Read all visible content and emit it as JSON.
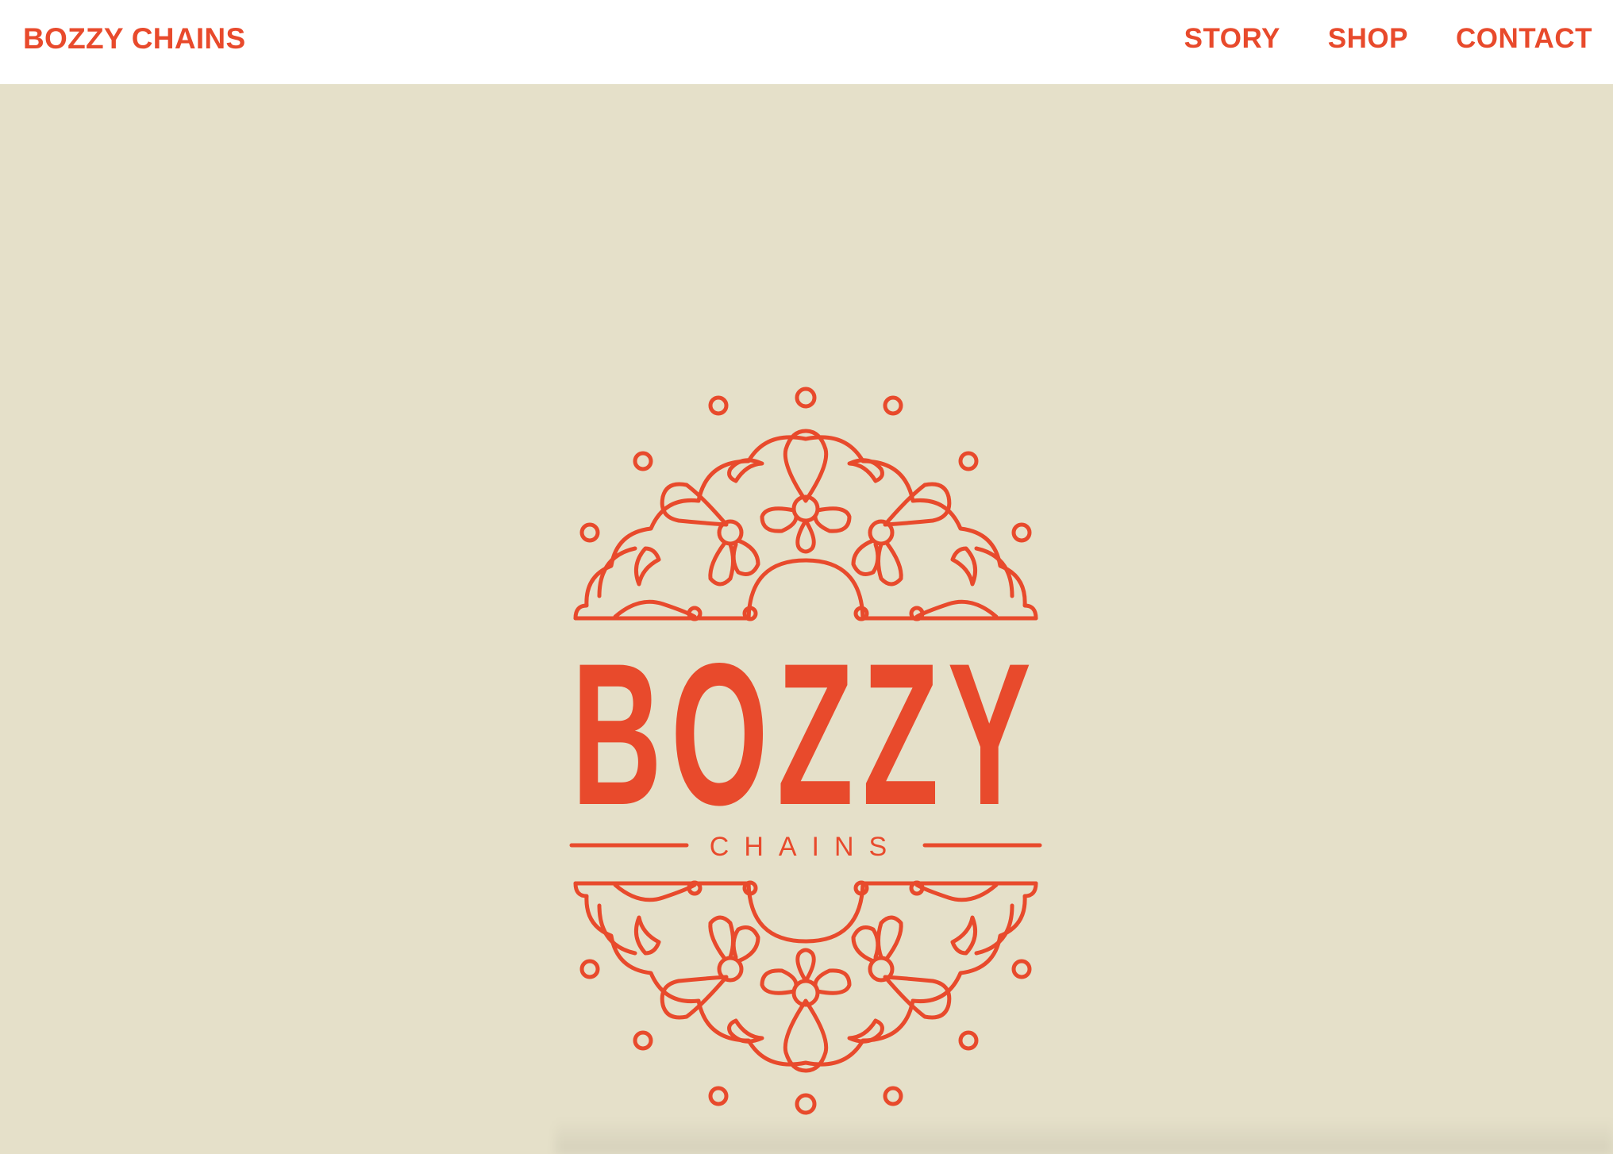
{
  "brand": {
    "name": "BOZZY CHAINS"
  },
  "nav": {
    "items": [
      {
        "label": "STORY"
      },
      {
        "label": "SHOP"
      },
      {
        "label": "CONTACT"
      }
    ]
  },
  "logo": {
    "wordmark": "BOZZY",
    "subtitle": "CHAINS",
    "icon": "mandala-ornament"
  },
  "colors": {
    "accent": "#e84a2c",
    "background": "#e5e0c9",
    "header": "#ffffff"
  }
}
